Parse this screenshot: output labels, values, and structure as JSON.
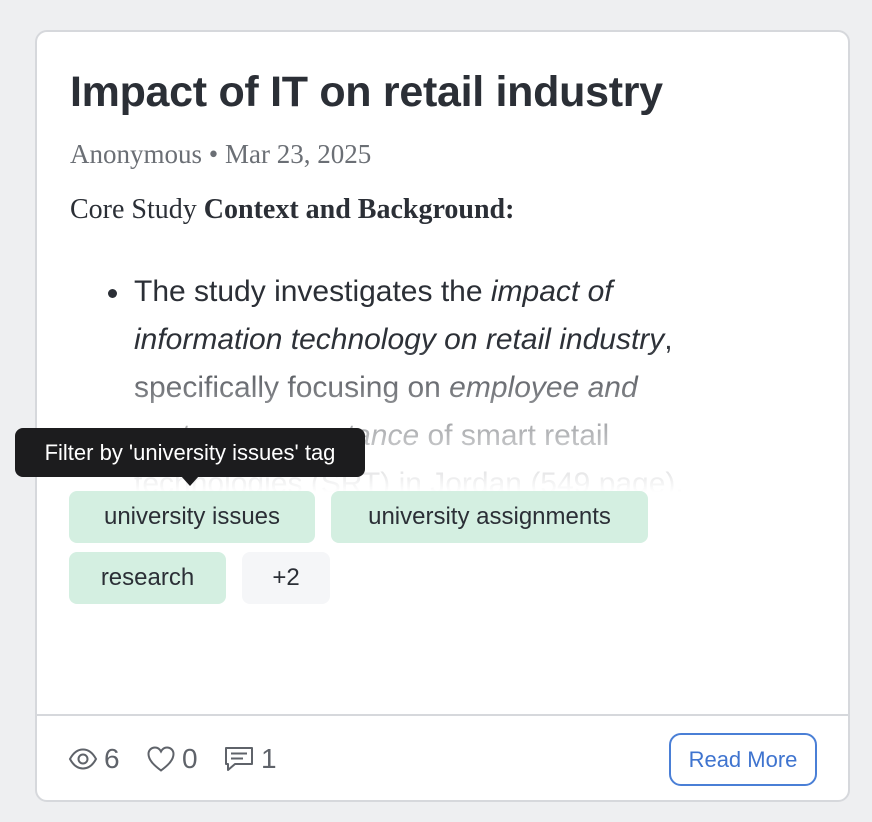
{
  "post": {
    "title": "Impact of IT on retail industry",
    "author": "Anonymous",
    "separator": "•",
    "date": "Mar 23, 2025",
    "lead_plain": "Core Study ",
    "lead_bold": "Context and Background:",
    "bullet": {
      "t1": "The study investigates the ",
      "t2_italic": "impact of information technology on retail industry",
      "t3": ", specifically focusing on ",
      "t4_italic": "employee and customer acceptance",
      "t5": " of smart retail technologies (SRT) in Jordan (549 page)."
    }
  },
  "tags": {
    "items": [
      "university issues",
      "university assignments",
      "research"
    ],
    "more_label": "+2"
  },
  "tooltip": {
    "text": "Filter by 'university issues' tag"
  },
  "stats": {
    "views": "6",
    "likes": "0",
    "comments": "1",
    "views_icon": "eye-icon",
    "likes_icon": "heart-icon",
    "comments_icon": "comment-icon"
  },
  "actions": {
    "read_more_label": "Read More"
  },
  "colors": {
    "tag_background": "#d4efe1",
    "accent": "#3f74cf",
    "tooltip_background": "#1c1c1e"
  }
}
